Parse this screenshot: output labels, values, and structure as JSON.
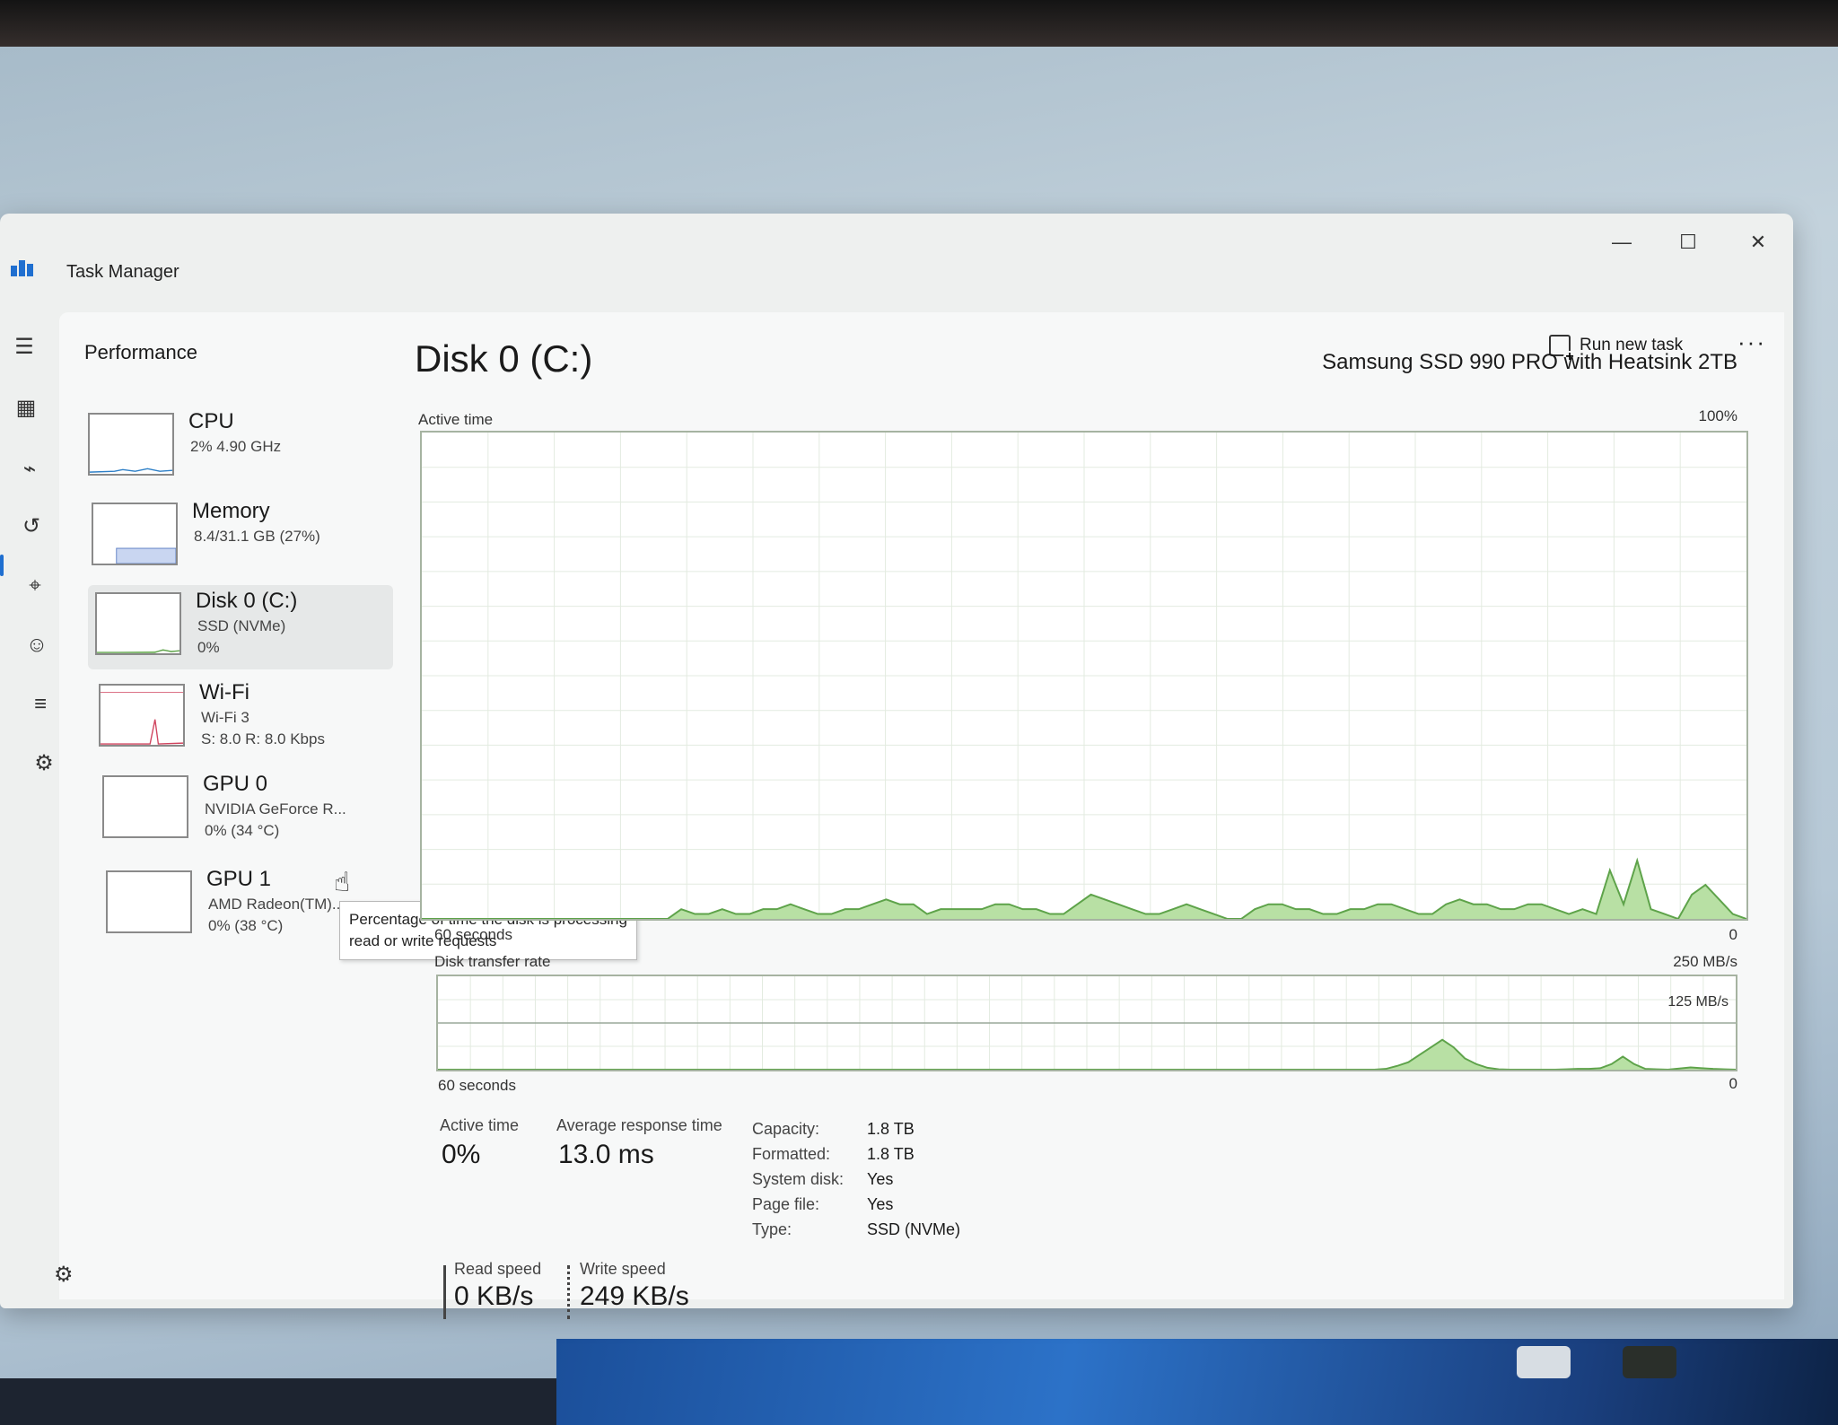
{
  "window": {
    "title": "Task Manager",
    "min_label": "—",
    "max_label": "☐",
    "close_label": "✕"
  },
  "header": {
    "page_title": "Performance",
    "run_new_task": "Run new task",
    "more": "···"
  },
  "sidebar": {
    "items": [
      {
        "name": "CPU",
        "sub": "2% 4.90 GHz",
        "sub2": ""
      },
      {
        "name": "Memory",
        "sub": "8.4/31.1 GB (27%)",
        "sub2": ""
      },
      {
        "name": "Disk 0 (C:)",
        "sub": "SSD (NVMe)",
        "sub2": "0%"
      },
      {
        "name": "Wi-Fi",
        "sub": "Wi-Fi 3",
        "sub2": "S: 8.0 R: 8.0 Kbps"
      },
      {
        "name": "GPU 0",
        "sub": "NVIDIA GeForce R...",
        "sub2": "0% (34 °C)"
      },
      {
        "name": "GPU 1",
        "sub": "AMD Radeon(TM)...",
        "sub2": "0% (38 °C)"
      }
    ]
  },
  "tooltip": {
    "text": "Percentage of time the disk is processing read or write requests"
  },
  "detail": {
    "title": "Disk 0 (C:)",
    "model": "Samsung SSD 990 PRO with Heatsink 2TB",
    "active_time_label": "Active time",
    "active_time_max": "100%",
    "active_time_min": "0",
    "seconds_label_1": "60 seconds",
    "transfer_label": "Disk transfer rate",
    "transfer_max": "250 MB/s",
    "transfer_mid": "125 MB/s",
    "transfer_min": "0",
    "seconds_label_2": "60 seconds"
  },
  "stats": {
    "active_time_label": "Active time",
    "active_time_value": "0%",
    "avg_response_label": "Average response time",
    "avg_response_value": "13.0 ms",
    "read_speed_label": "Read speed",
    "read_speed_value": "0 KB/s",
    "write_speed_label": "Write speed",
    "write_speed_value": "249 KB/s"
  },
  "properties": {
    "capacity_key": "Capacity:",
    "capacity_val": "1.8 TB",
    "formatted_key": "Formatted:",
    "formatted_val": "1.8 TB",
    "system_disk_key": "System disk:",
    "system_disk_val": "Yes",
    "page_file_key": "Page file:",
    "page_file_val": "Yes",
    "type_key": "Type:",
    "type_val": "SSD (NVMe)"
  },
  "chart_data": [
    {
      "type": "area",
      "title": "Active time",
      "ylim": [
        0,
        100
      ],
      "xlabel": "60 seconds",
      "values": [
        0,
        0,
        0,
        0,
        0,
        0,
        0,
        0,
        0,
        0,
        0,
        0,
        0,
        0,
        0,
        0,
        0,
        0,
        0,
        2,
        1,
        1,
        2,
        1,
        1,
        2,
        2,
        3,
        2,
        1,
        1,
        2,
        2,
        3,
        4,
        3,
        3,
        1,
        2,
        2,
        2,
        2,
        3,
        3,
        2,
        2,
        1,
        1,
        3,
        5,
        4,
        3,
        2,
        1,
        1,
        2,
        3,
        2,
        1,
        0,
        0,
        2,
        3,
        3,
        2,
        2,
        1,
        1,
        2,
        2,
        3,
        3,
        2,
        1,
        1,
        3,
        4,
        3,
        3,
        2,
        2,
        3,
        3,
        2,
        1,
        2,
        1,
        10,
        3,
        12,
        2,
        1,
        0,
        5,
        7,
        4,
        1,
        0
      ]
    },
    {
      "type": "area",
      "title": "Disk transfer rate",
      "ylim": [
        0,
        250
      ],
      "xlabel": "60 seconds",
      "values": [
        0,
        0,
        0,
        0,
        0,
        0,
        0,
        0,
        0,
        0,
        0,
        0,
        0,
        0,
        0,
        0,
        0,
        0,
        0,
        0,
        0,
        0,
        0,
        0,
        0,
        0,
        0,
        0,
        0,
        0,
        0,
        0,
        0,
        0,
        0,
        0,
        0,
        0,
        0,
        0,
        0,
        0,
        0,
        0,
        0,
        0,
        0,
        0,
        0,
        0,
        0,
        0,
        0,
        0,
        0,
        0,
        0,
        0,
        0,
        0,
        0,
        0,
        0,
        0,
        0,
        0,
        0,
        0,
        0,
        0,
        0,
        0,
        0,
        0,
        0,
        0,
        0,
        0,
        0,
        0,
        0,
        0,
        0,
        0,
        2,
        10,
        20,
        40,
        60,
        80,
        60,
        30,
        15,
        5,
        1,
        0,
        0,
        0,
        0,
        0,
        1,
        2,
        2,
        4,
        15,
        35,
        15,
        2,
        1,
        0,
        3,
        6,
        4,
        2,
        1,
        0
      ]
    }
  ],
  "colors": {
    "disk_fill": "#b8e0a4",
    "disk_line": "#5ea34a",
    "grid": "#e3ebe0",
    "wifi_line": "#d0455f"
  }
}
